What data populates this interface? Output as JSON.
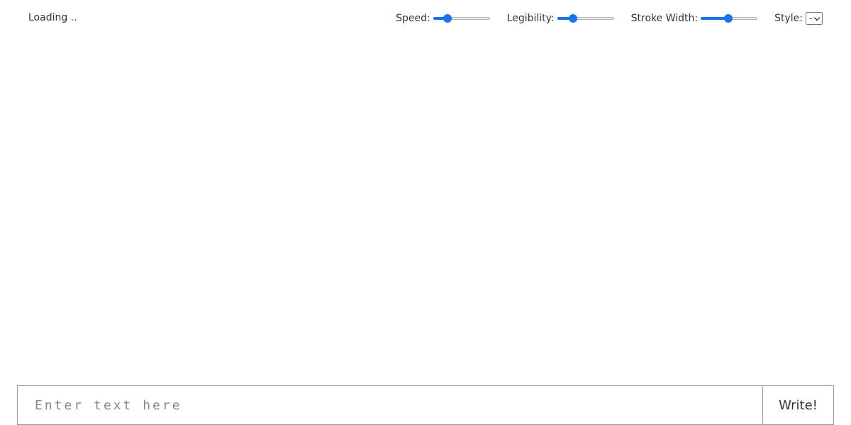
{
  "status": {
    "text": "Loading .."
  },
  "controls": {
    "speed": {
      "label": "Speed:",
      "value": 0.25
    },
    "legibility": {
      "label": "Legibility:",
      "value": 0.28
    },
    "stroke_width": {
      "label": "Stroke Width:",
      "value": 0.48
    },
    "style": {
      "label": "Style:",
      "selected": "–"
    }
  },
  "input": {
    "placeholder": "Enter text here",
    "value": ""
  },
  "write_button": {
    "label": "Write!"
  },
  "colors": {
    "accent": "#1a73e8"
  }
}
